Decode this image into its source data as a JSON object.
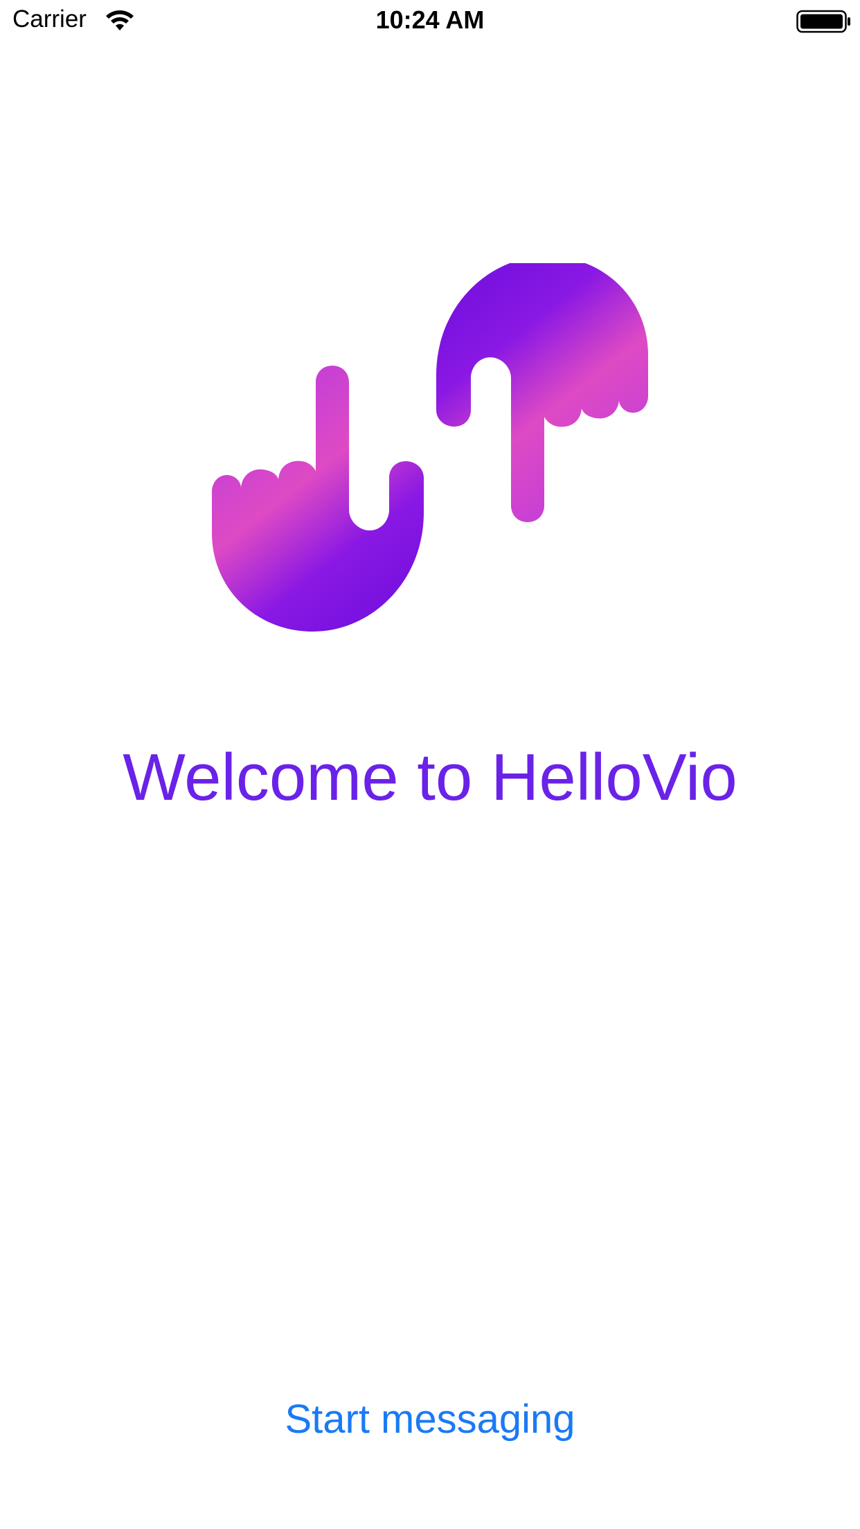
{
  "status_bar": {
    "carrier": "Carrier",
    "time": "10:24 AM",
    "wifi_icon": "wifi-icon",
    "battery_icon": "battery-full-icon"
  },
  "logo": {
    "icon": "hellovio-hands-logo",
    "gradient_colors": [
      "#d94bc4",
      "#7a16e2"
    ]
  },
  "welcome": {
    "title": "Welcome to HelloVio",
    "color": "#6a22e8"
  },
  "actions": {
    "start_label": "Start messaging",
    "link_color": "#1a7af5"
  }
}
